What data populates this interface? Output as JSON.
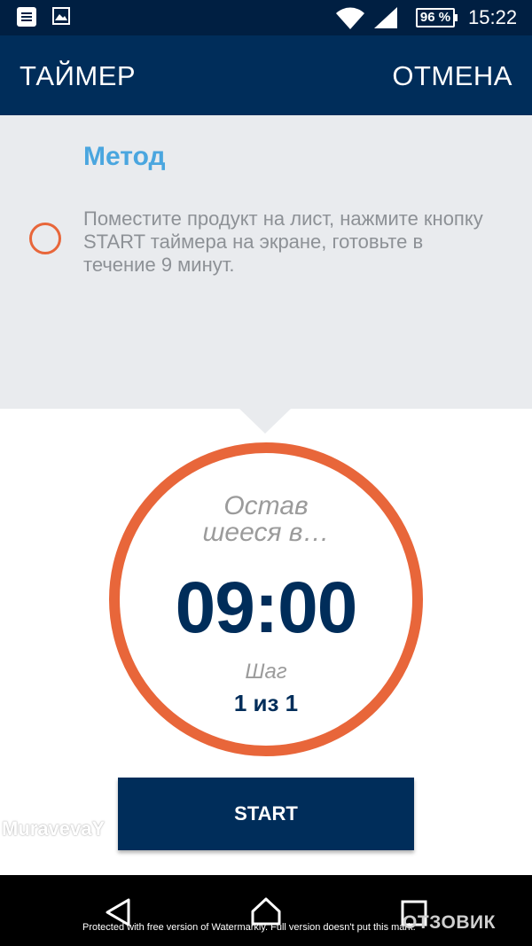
{
  "status_bar": {
    "battery": "96 %",
    "time": "15:22",
    "icons": [
      "notification-icon",
      "gallery-icon",
      "wifi-icon",
      "signal-icon",
      "battery-icon"
    ]
  },
  "app_bar": {
    "title": "ТАЙМЕР",
    "cancel_label": "ОТМЕНА"
  },
  "method": {
    "title": "Метод",
    "instruction": "Поместите продукт на лист, нажмите кнопку START таймера на экране, готовьте в течение 9 минут."
  },
  "timer": {
    "remaining_label_line1": "Остав",
    "remaining_label_line2": "шееся в…",
    "value": "09:00",
    "step_label": "Шаг",
    "step_count": "1 из 1"
  },
  "start_button": {
    "label": "START"
  },
  "watermark": {
    "user": "MuravevaY",
    "note": "Protected with free version of Watermarkly. Full version doesn't put this mark.",
    "logo": "ОТЗОВИК"
  },
  "colors": {
    "status_bar_bg": "#001f42",
    "app_bar_bg": "#002d5a",
    "accent_orange": "#e8663a",
    "method_title": "#4aa6df",
    "panel_bg": "#e9ebee"
  }
}
